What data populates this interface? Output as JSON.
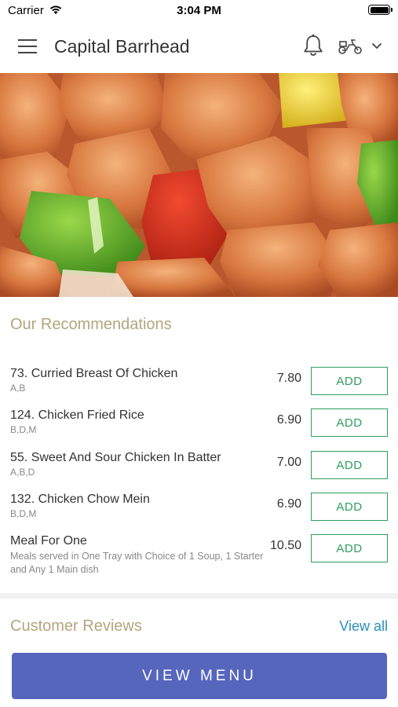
{
  "status_bar": {
    "carrier": "Carrier",
    "time": "3:04 PM"
  },
  "header": {
    "title": "Capital Barrhead",
    "icons": [
      "menu-icon",
      "bell-icon",
      "scooter-icon",
      "chevron-down-icon"
    ]
  },
  "hero": {
    "image": "sweet-and-sour-chicken-photo"
  },
  "recommendations": {
    "title": "Our Recommendations",
    "items": [
      {
        "name": "73. Curried Breast Of Chicken",
        "codes": "A,B",
        "price": "7.80",
        "button": "ADD"
      },
      {
        "name": "124. Chicken Fried Rice",
        "codes": "B,D,M",
        "price": "6.90",
        "button": "ADD"
      },
      {
        "name": "55. Sweet And Sour Chicken In Batter",
        "codes": "A,B,D",
        "price": "7.00",
        "button": "ADD"
      },
      {
        "name": "132. Chicken Chow Mein",
        "codes": "B,D,M",
        "price": "6.90",
        "button": "ADD"
      },
      {
        "name": "Meal For One",
        "description": "Meals served in One Tray with Choice of 1 Soup, 1 Starter and Any 1 Main dish",
        "price": "10.50",
        "button": "ADD"
      }
    ]
  },
  "reviews": {
    "title": "Customer Reviews",
    "view_all": "View all"
  },
  "footer": {
    "button": "VIEW MENU"
  },
  "colors": {
    "accent_gold": "#b3a57d",
    "add_green": "#2e9e5f",
    "link_blue": "#2a8fc0",
    "primary_button": "#5666bd"
  }
}
